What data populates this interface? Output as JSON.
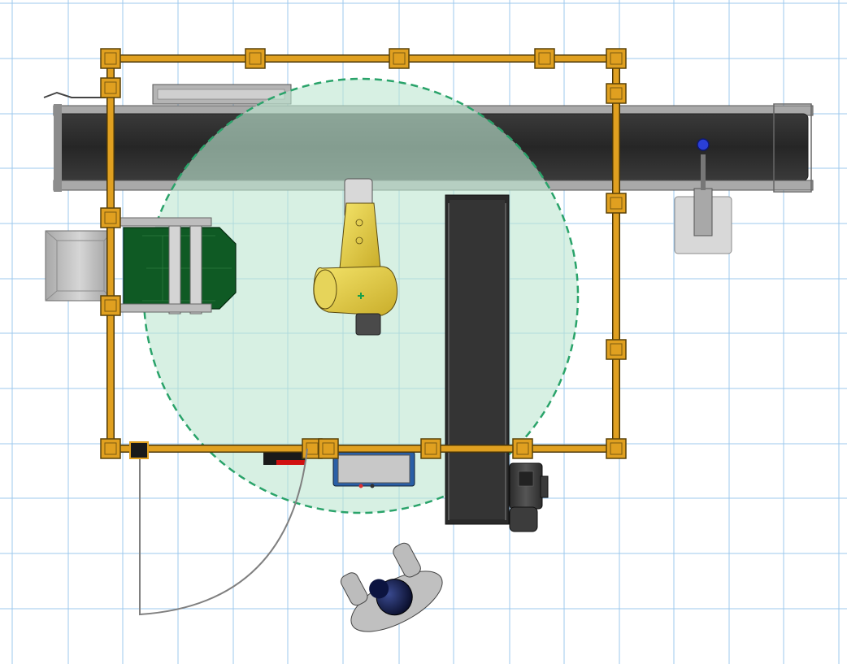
{
  "view": {
    "type": "robot-workcell-layout-top-view",
    "background": "#ffffff",
    "grid_color": "#9cc8ee"
  },
  "colors": {
    "fence": "#e0a020",
    "fence_dark": "#8a6410",
    "conveyor_belt": "#2c2c2c",
    "conveyor_frame": "#9a9a9a",
    "reach_zone_fill": "#bfe6d2",
    "reach_zone_stroke": "#2aa36a",
    "robot": "#e8d44a",
    "pallet": "#0f5a24",
    "control_cabinet": "#2a5fa6",
    "sensor": "#2a3fd8",
    "operator": "#0c1440",
    "door_swing": "#808080",
    "light_curtain": "#d01010"
  },
  "components": [
    {
      "name": "safety-fence",
      "kind": "perimeter fence"
    },
    {
      "name": "infeed-conveyor",
      "kind": "conveyor"
    },
    {
      "name": "outfeed-conveyor",
      "kind": "conveyor"
    },
    {
      "name": "robot-arm",
      "kind": "industrial robot"
    },
    {
      "name": "robot-reach-zone",
      "kind": "reach envelope"
    },
    {
      "name": "pallet-station",
      "kind": "pallet"
    },
    {
      "name": "control-cabinet",
      "kind": "controller"
    },
    {
      "name": "motor",
      "kind": "drive motor"
    },
    {
      "name": "sensor-stand",
      "kind": "sensor"
    },
    {
      "name": "access-door",
      "kind": "swing door"
    },
    {
      "name": "operator",
      "kind": "human operator"
    }
  ]
}
